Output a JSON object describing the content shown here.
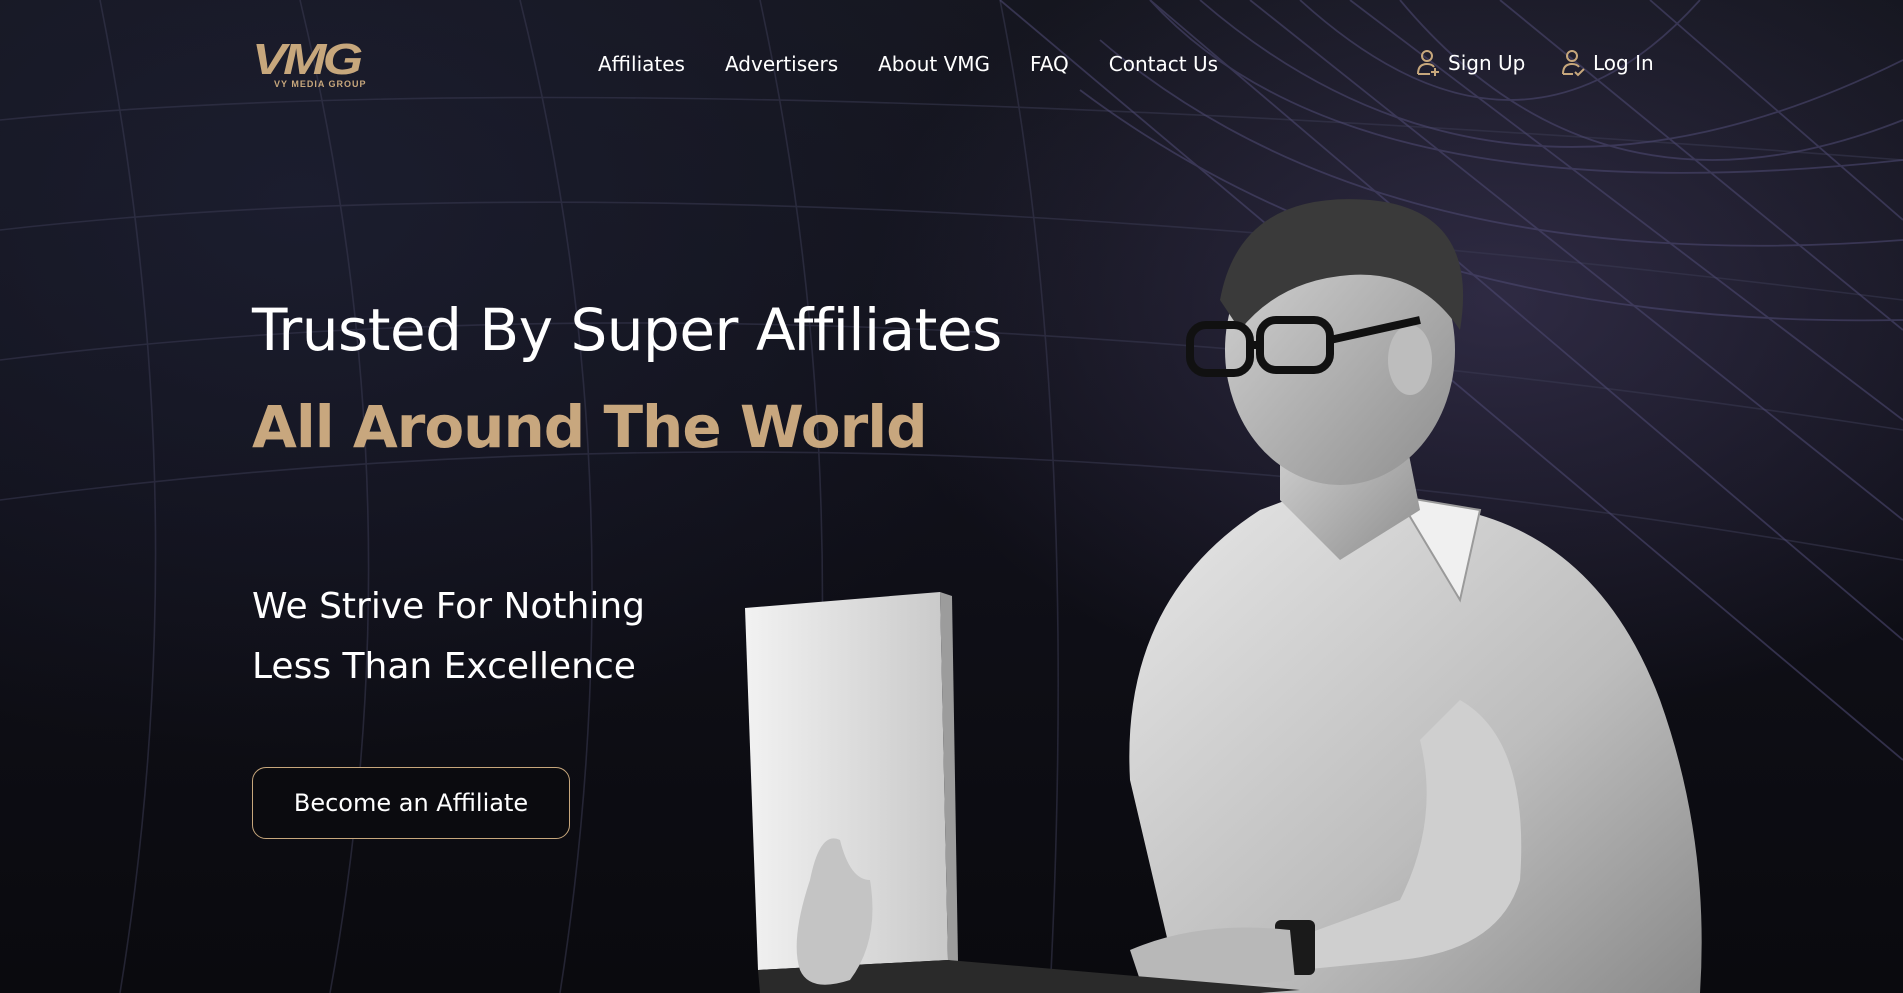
{
  "brand": {
    "logo_text": "VMG",
    "logo_subtitle": "VY MEDIA GROUP",
    "accent_color": "#c7a77c"
  },
  "nav": {
    "items": [
      {
        "label": "Affiliates"
      },
      {
        "label": "Advertisers"
      },
      {
        "label": "About VMG"
      },
      {
        "label": "FAQ"
      },
      {
        "label": "Contact Us"
      }
    ]
  },
  "auth": {
    "signup_label": "Sign Up",
    "signup_icon": "user-plus-icon",
    "login_label": "Log In",
    "login_icon": "user-check-icon"
  },
  "hero": {
    "title_line1": "Trusted By Super Affiliates",
    "title_line2": "All Around The World",
    "tagline_line1": "We Strive For Nothing",
    "tagline_line2": "Less Than Excellence",
    "cta_label": "Become an Affiliate",
    "image": "man-with-laptop-photo"
  }
}
